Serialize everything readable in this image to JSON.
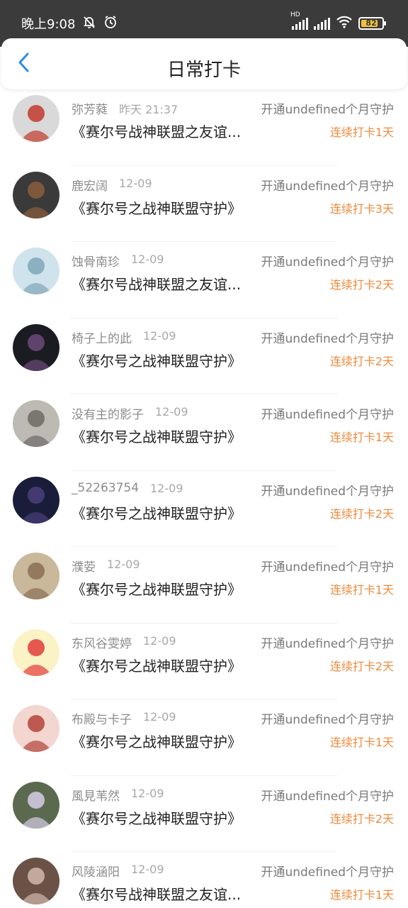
{
  "status_bar": {
    "time": "晚上9:08",
    "hd_label": "HD",
    "battery": "82",
    "battery_level": 0.82
  },
  "header": {
    "title": "日常打卡",
    "back_icon": "chevron-left-icon",
    "accent_color": "#2d8ce8"
  },
  "colors": {
    "streak": "#f08a3b",
    "status_bg": "#3b3b3b"
  },
  "rows": [
    {
      "name": "弥芳蕤",
      "time": "昨天 21:37",
      "guard": "开通undefined个月守护",
      "title": "《赛尔号战神联盟之友谊...",
      "streak": "连续打卡1天"
    },
    {
      "name": "鹿宏阔",
      "time": "12-09",
      "guard": "开通undefined个月守护",
      "title": "《赛尔号之战神联盟守护》",
      "streak": "连续打卡3天"
    },
    {
      "name": "蚀骨南珍",
      "time": "12-09",
      "guard": "开通undefined个月守护",
      "title": "《赛尔号战神联盟之友谊...",
      "streak": "连续打卡2天"
    },
    {
      "name": "椅子上的此",
      "time": "12-09",
      "guard": "开通undefined个月守护",
      "title": "《赛尔号之战神联盟守护》",
      "streak": "连续打卡2天"
    },
    {
      "name": "没有主的影子",
      "time": "12-09",
      "guard": "开通undefined个月守护",
      "title": "《赛尔号之战神联盟守护》",
      "streak": "连续打卡1天"
    },
    {
      "name": "_52263754",
      "time": "12-09",
      "guard": "开通undefined个月守护",
      "title": "《赛尔号之战神联盟守护》",
      "streak": "连续打卡2天"
    },
    {
      "name": "濮荌",
      "time": "12-09",
      "guard": "开通undefined个月守护",
      "title": "《赛尔号之战神联盟守护》",
      "streak": "连续打卡1天"
    },
    {
      "name": "东风谷雯婷",
      "time": "12-09",
      "guard": "开通undefined个月守护",
      "title": "《赛尔号之战神联盟守护》",
      "streak": "连续打卡2天"
    },
    {
      "name": "布殿与卡子",
      "time": "12-09",
      "guard": "开通undefined个月守护",
      "title": "《赛尔号之战神联盟守护》",
      "streak": "连续打卡1天"
    },
    {
      "name": "風見苇然",
      "time": "12-09",
      "guard": "开通undefined个月守护",
      "title": "《赛尔号之战神联盟守护》",
      "streak": "连续打卡2天"
    },
    {
      "name": "风陵涵阳",
      "time": "12-09",
      "guard": "开通undefined个月守护",
      "title": "《赛尔号战神联盟之友谊...",
      "streak": "连续打卡1天"
    }
  ]
}
